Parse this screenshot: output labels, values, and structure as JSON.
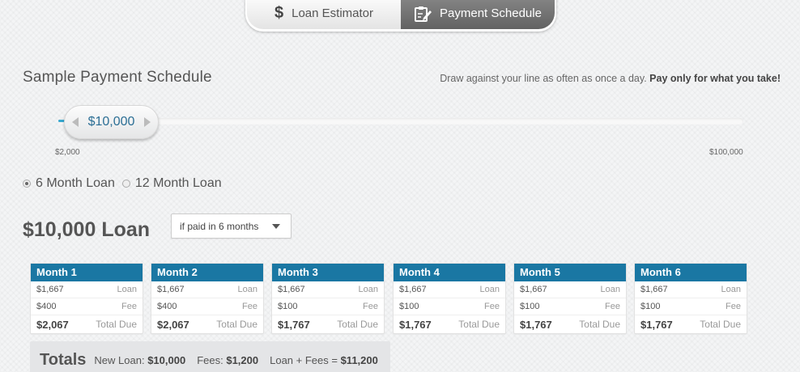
{
  "tabs": {
    "estimator": {
      "label": "Loan Estimator",
      "icon": "dollar-icon"
    },
    "schedule": {
      "label": "Payment Schedule",
      "icon": "clipboard-edit-icon"
    }
  },
  "header": {
    "title": "Sample Payment Schedule",
    "tagline": "Draw against your line as often as once a day.",
    "tagline_bold": "Pay only for what you take!"
  },
  "slider": {
    "value_label": "$10,000",
    "min_label": "$2,000",
    "max_label": "$100,000",
    "value": 10000,
    "min": 2000,
    "max": 100000
  },
  "terms": [
    {
      "label": "6 Month Loan",
      "checked": true
    },
    {
      "label": "12 Month Loan",
      "checked": false
    }
  ],
  "loan": {
    "title": "$10,000 Loan",
    "dropdown_value": "if paid in 6 months"
  },
  "months": [
    {
      "name": "Month 1",
      "loan": "$1,667",
      "loan_label": "Loan",
      "fee": "$400",
      "fee_label": "Fee",
      "total": "$2,067",
      "total_label": "Total Due"
    },
    {
      "name": "Month 2",
      "loan": "$1,667",
      "loan_label": "Loan",
      "fee": "$400",
      "fee_label": "Fee",
      "total": "$2,067",
      "total_label": "Total Due"
    },
    {
      "name": "Month 3",
      "loan": "$1,667",
      "loan_label": "Loan",
      "fee": "$100",
      "fee_label": "Fee",
      "total": "$1,767",
      "total_label": "Total Due"
    },
    {
      "name": "Month 4",
      "loan": "$1,667",
      "loan_label": "Loan",
      "fee": "$100",
      "fee_label": "Fee",
      "total": "$1,767",
      "total_label": "Total Due"
    },
    {
      "name": "Month 5",
      "loan": "$1,667",
      "loan_label": "Loan",
      "fee": "$100",
      "fee_label": "Fee",
      "total": "$1,767",
      "total_label": "Total Due"
    },
    {
      "name": "Month 6",
      "loan": "$1,667",
      "loan_label": "Loan",
      "fee": "$100",
      "fee_label": "Fee",
      "total": "$1,767",
      "total_label": "Total Due"
    }
  ],
  "totals": {
    "title": "Totals",
    "new_loan_label": "New Loan:",
    "new_loan": "$10,000",
    "fees_label": "Fees:",
    "fees": "$1,200",
    "sum_label": "Loan + Fees =",
    "sum": "$11,200"
  },
  "colors": {
    "accent": "#1a77a3",
    "slider_fill": "#38a8cf",
    "active_tab": "#6e6e6e"
  }
}
